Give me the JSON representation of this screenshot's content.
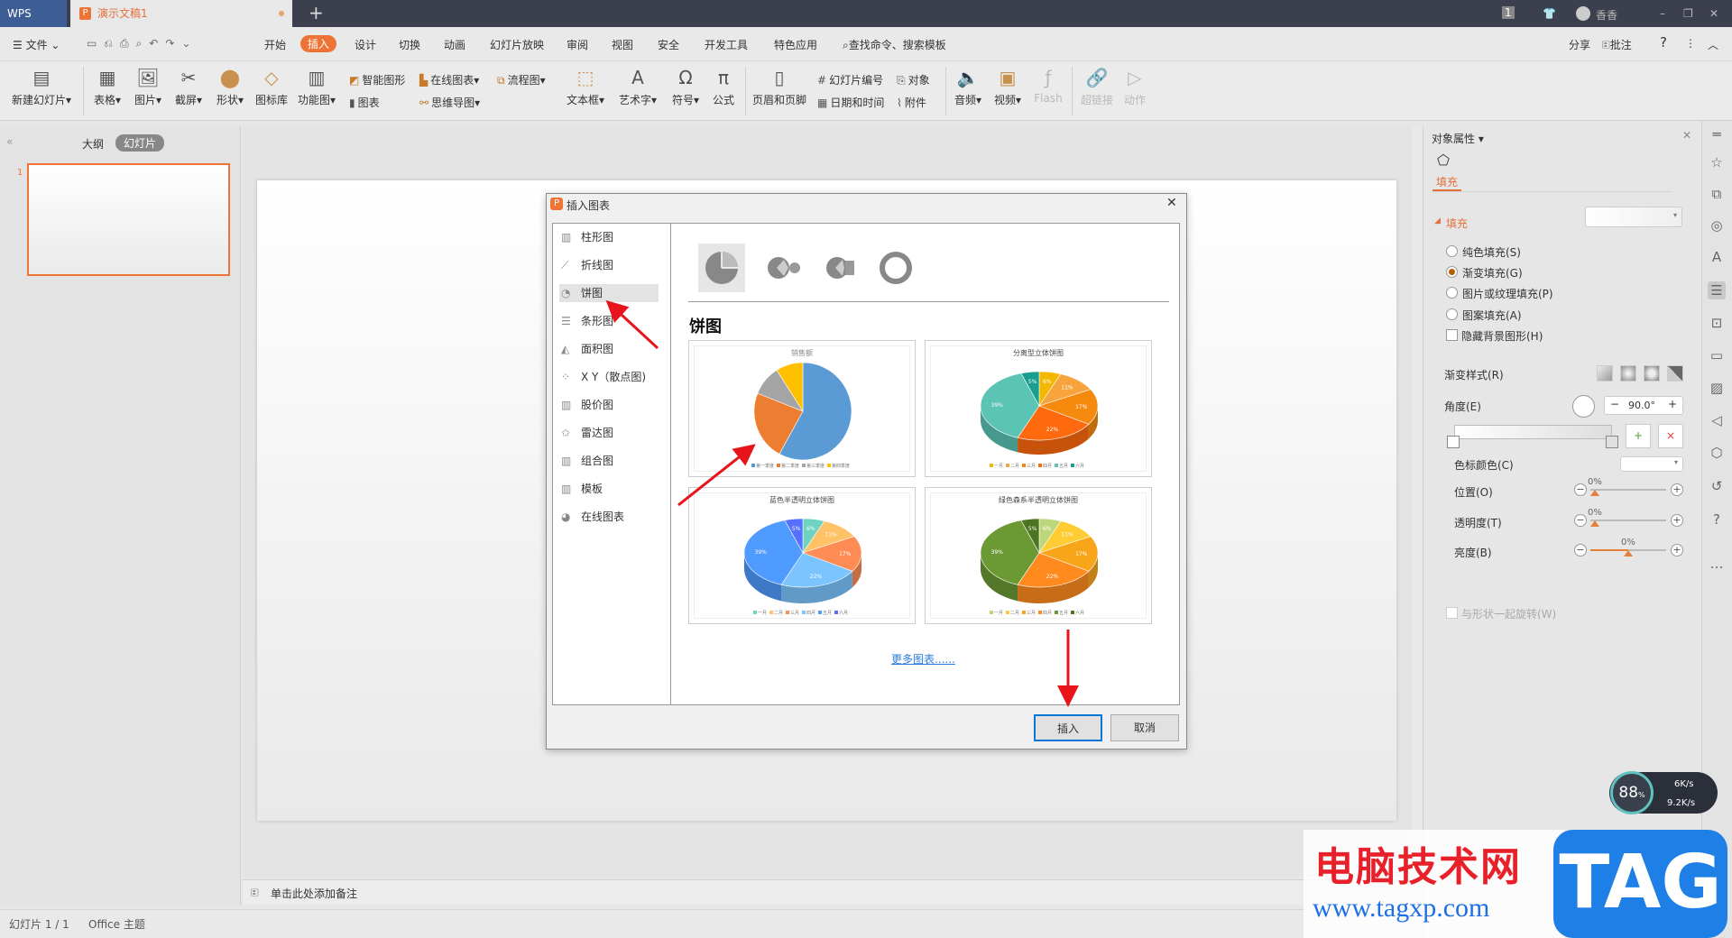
{
  "titlebar": {
    "app": "WPS",
    "doc_tab": "演示文稿1",
    "new_tab": "+",
    "page_badge": "1",
    "user": "香香"
  },
  "menu": {
    "file": "文件",
    "tabs": [
      "开始",
      "插入",
      "设计",
      "切换",
      "动画",
      "幻灯片放映",
      "审阅",
      "视图",
      "安全",
      "开发工具",
      "特色应用"
    ],
    "active_tab": "插入",
    "search": "查找命令、搜索模板",
    "share": "分享",
    "comment": "批注",
    "help": "?"
  },
  "ribbon": {
    "new_slide": "新建幻灯片",
    "table": "表格",
    "picture": "图片",
    "screenshot": "截屏",
    "shape": "形状",
    "icon_lib": "图标库",
    "func_chart": "功能图",
    "smart_art": "智能图形",
    "chart": "图表",
    "online_chart": "在线图表",
    "mind_map": "思维导图",
    "flowchart": "流程图",
    "textbox": "文本框",
    "wordart": "艺术字",
    "symbol": "符号",
    "formula": "公式",
    "header_footer": "页眉和页脚",
    "slide_number": "幻灯片编号",
    "datetime": "日期和时间",
    "object": "对象",
    "attachment": "附件",
    "audio": "音频",
    "video": "视频",
    "flash": "Flash",
    "hyperlink": "超链接",
    "action": "动作"
  },
  "left_panel": {
    "tab_outline": "大纲",
    "tab_slides": "幻灯片",
    "slide_number": "1"
  },
  "notes": {
    "placeholder": "单击此处添加备注"
  },
  "status": {
    "slide_info": "幻灯片 1 / 1",
    "theme": "Office 主题"
  },
  "right_panel": {
    "title": "对象属性",
    "tab": "填充",
    "section": "填充",
    "options": [
      "纯色填充(S)",
      "渐变填充(G)",
      "图片或纹理填充(P)",
      "图案填充(A)"
    ],
    "selected_option": "渐变填充(G)",
    "hide_bg": "隐藏背景图形(H)",
    "gradient_style": "渐变样式(R)",
    "angle_label": "角度(E)",
    "angle_value": "90.0°",
    "stop_color": "色标颜色(C)",
    "position": {
      "label": "位置(O)",
      "value": "0%"
    },
    "transparency": {
      "label": "透明度(T)",
      "value": "0%"
    },
    "brightness": {
      "label": "亮度(B)",
      "value": "0%"
    },
    "rotate_with_shape": "与形状一起旋转(W)"
  },
  "dialog": {
    "title": "插入图表",
    "categories": [
      "柱形图",
      "折线图",
      "饼图",
      "条形图",
      "面积图",
      "X Y（散点图)",
      "股价图",
      "雷达图",
      "组合图",
      "模板",
      "在线图表"
    ],
    "selected_category": "饼图",
    "heading": "饼图",
    "more": "更多图表......",
    "insert": "插入",
    "cancel": "取消"
  },
  "chart_data": [
    {
      "type": "pie",
      "title": "销售额",
      "categories": [
        "第一季度",
        "第二季度",
        "第三季度",
        "第四季度"
      ],
      "values": [
        58,
        23,
        10,
        9
      ],
      "colors": [
        "#5b9bd5",
        "#ed7d31",
        "#a5a5a5",
        "#ffc000"
      ]
    },
    {
      "type": "pie",
      "title": "分离型立体饼图",
      "categories": [
        "一月",
        "二月",
        "三月",
        "四月",
        "五月",
        "六月"
      ],
      "values": [
        6,
        11,
        17,
        22,
        39,
        5
      ],
      "labels": [
        "6%",
        "11%",
        "17%",
        "22%",
        "39%",
        "5%"
      ],
      "colors": [
        "#f5b800",
        "#f8a43c",
        "#f58a0f",
        "#ff6a0e",
        "#5cc4b5",
        "#1a9e8f"
      ]
    },
    {
      "type": "pie",
      "title": "蓝色半透明立体饼图",
      "categories": [
        "一月",
        "二月",
        "三月",
        "四月",
        "五月",
        "六月"
      ],
      "values": [
        6,
        11,
        17,
        22,
        39,
        5
      ],
      "labels": [
        "6%",
        "11%",
        "17%",
        "22%",
        "39%",
        "5%"
      ],
      "colors": [
        "#6fd3c2",
        "#ffc266",
        "#ff8c55",
        "#7cc4ff",
        "#4f9bff",
        "#5670ff"
      ]
    },
    {
      "type": "pie",
      "title": "绿色森系半透明立体饼图",
      "categories": [
        "一月",
        "二月",
        "三月",
        "四月",
        "五月",
        "六月"
      ],
      "values": [
        6,
        11,
        17,
        22,
        39,
        5
      ],
      "labels": [
        "6%",
        "11%",
        "17%",
        "22%",
        "39%",
        "5%"
      ],
      "colors": [
        "#bcd67a",
        "#ffcc33",
        "#f9a51a",
        "#ff8a1e",
        "#6b9a35",
        "#4d7420"
      ]
    }
  ],
  "widget": {
    "cpu": "88",
    "up": "6K/s",
    "down": "9.2K/s"
  },
  "watermark": {
    "cn": "电脑技术网",
    "tag": "TAG",
    "url": "www.tagxp.com"
  }
}
